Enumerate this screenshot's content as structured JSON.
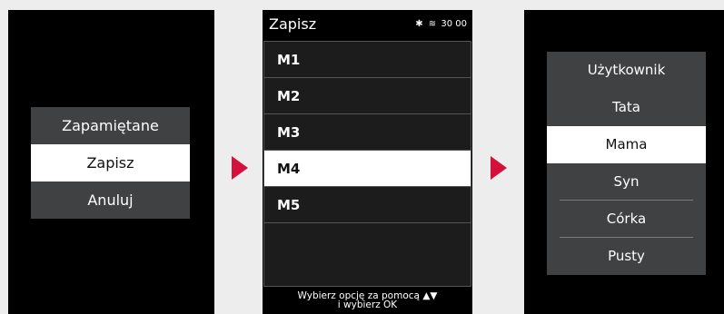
{
  "screen1": {
    "menu": [
      {
        "label": "Zapamiętane"
      },
      {
        "label": "Zapisz"
      },
      {
        "label": "Anuluj"
      }
    ]
  },
  "screen2": {
    "title": "Zapisz",
    "status": {
      "bluetooth_icon": "bluetooth-icon",
      "heat_icon": "heat-icon",
      "time": "30 00"
    },
    "rows": [
      {
        "label": "M1"
      },
      {
        "label": "M2"
      },
      {
        "label": "M3"
      },
      {
        "label": "M4"
      },
      {
        "label": "M5"
      }
    ],
    "footer_line1": "Wybierz opcję za pomocą",
    "footer_line2": "i wybierz OK"
  },
  "screen3": {
    "menu": [
      {
        "label": "Użytkownik"
      },
      {
        "label": "Tata"
      },
      {
        "label": "Mama"
      },
      {
        "label": "Syn"
      },
      {
        "label": "Córka"
      },
      {
        "label": "Pusty"
      }
    ]
  },
  "colors": {
    "accent_arrow": "#d4103c",
    "screen_bg": "#000000",
    "menu_bg": "#3f4142",
    "page_bg": "#ededed"
  }
}
